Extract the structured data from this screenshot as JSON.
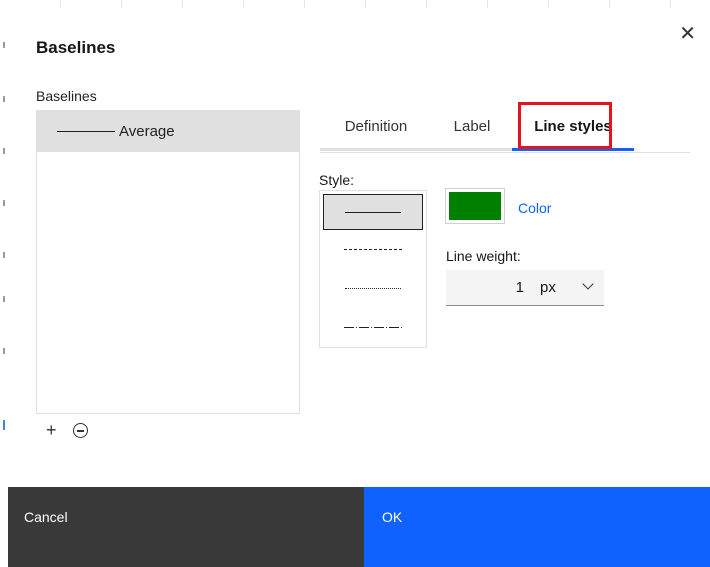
{
  "dialog": {
    "title": "Baselines",
    "close_icon": "close-icon"
  },
  "baselines": {
    "label": "Baselines",
    "items": [
      {
        "label": "Average",
        "selected": true
      }
    ],
    "actions": {
      "add_icon": "plus-icon",
      "remove_icon": "minus-circle-icon",
      "add_symbol": "+"
    }
  },
  "tabs": [
    {
      "label": "Definition",
      "active": false
    },
    {
      "label": "Label",
      "active": false
    },
    {
      "label": "Line styles",
      "active": true
    }
  ],
  "line_styles": {
    "style_label": "Style:",
    "styles": [
      {
        "name": "solid",
        "selected": true
      },
      {
        "name": "dashed",
        "selected": false
      },
      {
        "name": "dotted",
        "selected": false
      },
      {
        "name": "dash-dot",
        "selected": false
      }
    ],
    "color_label": "Color",
    "color_value": "#008000",
    "weight_label": "Line weight:",
    "weight_value": "1",
    "weight_unit": "px"
  },
  "footer": {
    "cancel_label": "Cancel",
    "ok_label": "OK"
  },
  "colors": {
    "accent": "#0f62fe",
    "cancel_bg": "#393939",
    "highlight": "#e4141c"
  }
}
